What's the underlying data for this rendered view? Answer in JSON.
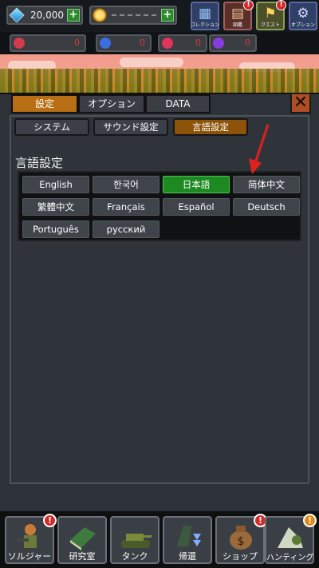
{
  "currency": {
    "gems": "20,000"
  },
  "top_menu": [
    {
      "label": "コレクション",
      "icon": "collection-icon"
    },
    {
      "label": "図鑑",
      "icon": "book-icon"
    },
    {
      "label": "クエスト",
      "icon": "quest-icon"
    },
    {
      "label": "オプション",
      "icon": "gear-icon"
    }
  ],
  "gem_counters": [
    {
      "value": "0",
      "color": "#d23b4a"
    },
    {
      "value": "0",
      "color": "#3b6fe0"
    },
    {
      "value": "0",
      "color": "#e0345a"
    },
    {
      "value": "0",
      "color": "#8a3be0"
    }
  ],
  "main_tabs": [
    {
      "label": "設定"
    },
    {
      "label": "オプション"
    },
    {
      "label": "DATA"
    }
  ],
  "sub_tabs": [
    {
      "label": "システム"
    },
    {
      "label": "サウンド設定"
    },
    {
      "label": "言語設定"
    }
  ],
  "section": {
    "title": "言語設定"
  },
  "languages": [
    {
      "label": "English"
    },
    {
      "label": "한국어"
    },
    {
      "label": "日本語",
      "selected": true
    },
    {
      "label": "简体中文"
    },
    {
      "label": "繁體中文"
    },
    {
      "label": "Français"
    },
    {
      "label": "Español"
    },
    {
      "label": "Deutsch"
    },
    {
      "label": "Português"
    },
    {
      "label": "русский"
    }
  ],
  "bottom_nav": [
    {
      "label": "ソルジャー",
      "icon": "soldier-icon",
      "alert": "red"
    },
    {
      "label": "研究室",
      "icon": "research-book-icon"
    },
    {
      "label": "タンク",
      "icon": "tank-icon"
    },
    {
      "label": "帰還",
      "icon": "return-icon"
    },
    {
      "label": "ショップ",
      "icon": "money-bag-icon",
      "alert": "red"
    },
    {
      "label": "ハンティング",
      "icon": "hunting-icon",
      "alert": "orange"
    }
  ],
  "alert_mark": "!",
  "accent": {
    "active_tab": "#b86e12",
    "selected_language": "#1c8a21",
    "arrow": "#e0201c"
  }
}
